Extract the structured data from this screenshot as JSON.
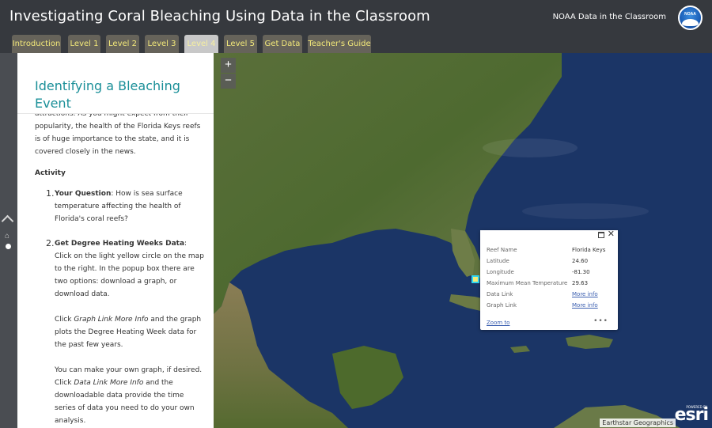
{
  "header": {
    "title": "Investigating Coral Bleaching Using Data in the Classroom",
    "brand": "NOAA Data in the Classroom",
    "logo_text": "NOAA"
  },
  "tabs": [
    {
      "label": "Introduction",
      "active": false
    },
    {
      "label": "Level 1",
      "active": false
    },
    {
      "label": "Level 2",
      "active": false
    },
    {
      "label": "Level 3",
      "active": false
    },
    {
      "label": "Level 4",
      "active": true
    },
    {
      "label": "Level 5",
      "active": false
    },
    {
      "label": "Get Data",
      "active": false
    },
    {
      "label": "Teacher's Guide",
      "active": false
    }
  ],
  "panel": {
    "title": "Identifying a Bleaching Event",
    "intro": "attractions. As you might expect from their popularity, the health of the Florida Keys reefs is of huge importance to the state, and it is covered closely in the news.",
    "activity_heading": "Activity",
    "items": [
      {
        "num": "1.",
        "bold": "Your Question",
        "text": ": How is sea surface temperature affecting the health of Florida's coral reefs?"
      },
      {
        "num": "2.",
        "bold": "Get Degree Heating Weeks Data",
        "text": ": Click on the light yellow circle on the map to the right. In the popup box there are two options: download a graph, or download data.",
        "sub1_italic": "Graph Link More Info",
        "sub1_pre": "Click ",
        "sub1_post": " and the graph plots the Degree Heating Week data for the past few years.",
        "sub2_pre": "You can make your own graph, if desired. Click ",
        "sub2_italic": "Data Link More Info",
        "sub2_post": " and the downloadable data provide the time series of data you need to do your own analysis."
      }
    ]
  },
  "map": {
    "zoom_in": "+",
    "zoom_out": "−",
    "attribution": "Earthstar Geographics",
    "powered_by": "POWERED BY",
    "esri": "esri"
  },
  "popup": {
    "close": "✕",
    "rows": [
      {
        "label": "Reef Name",
        "value": "Florida Keys"
      },
      {
        "label": "Latitude",
        "value": "24.60"
      },
      {
        "label": "Longitude",
        "value": "-81.30"
      },
      {
        "label": "Maximum Mean Temperature",
        "value": "29.63"
      },
      {
        "label": "Data Link",
        "value": "More info"
      },
      {
        "label": "Graph Link",
        "value": "More info"
      }
    ],
    "zoom_to": "Zoom to",
    "more": "•••"
  },
  "colors": {
    "header_bg": "#36393e",
    "tab_text": "#f3e97a",
    "title_teal": "#1a8f98",
    "link_blue": "#3b5fb0",
    "marker_yellow": "#f4ec7a"
  }
}
